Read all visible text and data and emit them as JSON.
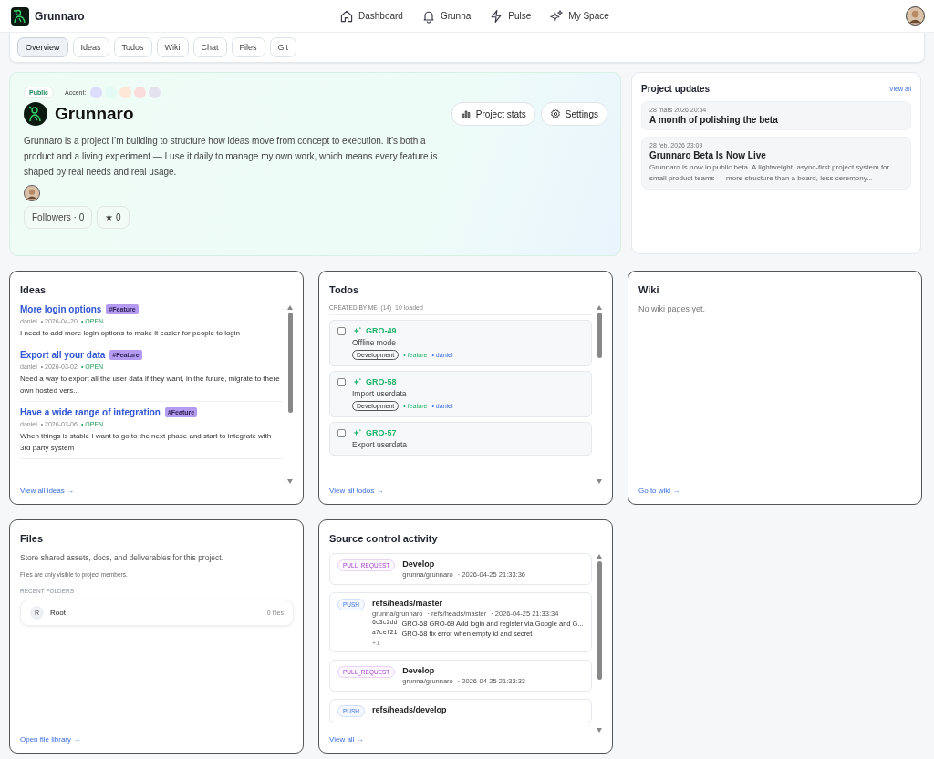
{
  "header": {
    "brand": "Grunnaro",
    "nav": [
      {
        "label": "Dashboard"
      },
      {
        "label": "Grunna"
      },
      {
        "label": "Pulse"
      },
      {
        "label": "My Space"
      }
    ]
  },
  "tabs": [
    {
      "label": "Overview",
      "selected": true
    },
    {
      "label": "Ideas",
      "selected": false
    },
    {
      "label": "Todos",
      "selected": false
    },
    {
      "label": "Wiki",
      "selected": false
    },
    {
      "label": "Chat",
      "selected": false
    },
    {
      "label": "Files",
      "selected": false
    },
    {
      "label": "Git",
      "selected": false
    }
  ],
  "hero": {
    "visibility": "Public",
    "accent_label": "Accent:",
    "accents": [
      {
        "color": "#dcdcfb"
      },
      {
        "color": "#e3faf5"
      },
      {
        "color": "#fde8d8"
      },
      {
        "color": "#fbdcdc"
      },
      {
        "color": "#e4e2ee"
      }
    ],
    "title": "Grunnaro",
    "description": "Grunnaro is a project I’m building to structure how ideas move from concept to execution. It’s both a product and a living experiment — I use it daily to manage my own work, which means every feature is shaped by real needs and real usage.",
    "buttons": [
      {
        "label": "Project stats"
      },
      {
        "label": "Settings"
      }
    ],
    "followers": "Followers · 0",
    "stars": "★ 0"
  },
  "updates": {
    "title": "Project updates",
    "view_all": "View all",
    "items": [
      {
        "date": "28 mars 2026 20:54",
        "title": "A month of polishing the beta"
      },
      {
        "date": "28 feb. 2026 23:09",
        "title": "Grunnaro Beta Is Now Live",
        "summary": "Grunnaro is now in public beta. A lightweight, async-first project system for small product teams — more structure than a board, less ceremony..."
      }
    ]
  },
  "ideas": {
    "title": "Ideas",
    "items": [
      {
        "title": "More login options",
        "tag": "#Feature",
        "author": "daniel",
        "date": "• 2026-04-20",
        "status": "• OPEN",
        "text": "I need to add more login options to make it easier for people to login"
      },
      {
        "title": "Export all your data",
        "tag": "#Feature",
        "author": "daniel",
        "date": "• 2026-03-02",
        "status": "• OPEN",
        "text": "Need a way to export all the user data if they want, in the future, migrate to there own hosted vers..."
      },
      {
        "title": "Have a wide range of integration",
        "tag": "#Feature",
        "author": "daniel",
        "date": "• 2026-03-06",
        "status": "• OPEN",
        "text": "When things is stable I want to go to the next phase and start to integrate with 3rd party system"
      }
    ],
    "link": "View all ideas →"
  },
  "todos": {
    "title": "Todos",
    "group": "CREATED BY ME",
    "count": "(14)",
    "loaded": "10 loaded",
    "items": [
      {
        "key": "GRO-49",
        "title": "Offline mode",
        "checked": false,
        "stage": "Development",
        "type": "• feature",
        "assignee": "• daniel"
      },
      {
        "key": "GRO-58",
        "title": "Import userdata",
        "checked": false,
        "stage": "Development",
        "type": "• feature",
        "assignee": "• daniel"
      },
      {
        "key": "GRO-57",
        "title": "Export userdata",
        "checked": false
      }
    ],
    "link": "View all todos →"
  },
  "wiki": {
    "title": "Wiki",
    "empty": "No wiki pages yet.",
    "link": "Go to wiki →"
  },
  "files": {
    "title": "Files",
    "description": "Store shared assets, docs, and deliverables for this project.",
    "note": "Files are only visible to project members.",
    "section": "RECENT FOLDERS",
    "folders": [
      {
        "initial": "R",
        "name": "Root",
        "count": "0 files"
      }
    ],
    "link": "Open file library →"
  },
  "source": {
    "title": "Source control activity",
    "items": [
      {
        "kind": "pull_request",
        "badge": "PULL_REQUEST",
        "title": "Develop",
        "repo": "grunna/grunnaro",
        "time": "· 2026-04-25 21:33:36"
      },
      {
        "kind": "push",
        "badge": "PUSH",
        "title": "refs/heads/master",
        "repo": "grunna/grunnaro",
        "ref": "· refs/heads/master",
        "time": "· 2026-04-25 21:33:34",
        "commits": [
          {
            "sha": "6c3c2dd",
            "message": "GRO-68 GRO-69 Add login and register via Google and G..."
          },
          {
            "sha": "a7cef21",
            "message": "GRO-68 fix error when empty id and secret"
          }
        ],
        "more": "+1"
      },
      {
        "kind": "pull_request",
        "badge": "PULL_REQUEST",
        "title": "Develop",
        "repo": "grunna/grunnaro",
        "time": "· 2026-04-25 21:33:33"
      },
      {
        "kind": "push",
        "badge": "PUSH",
        "title": "refs/heads/develop"
      }
    ],
    "link": "View all →"
  }
}
